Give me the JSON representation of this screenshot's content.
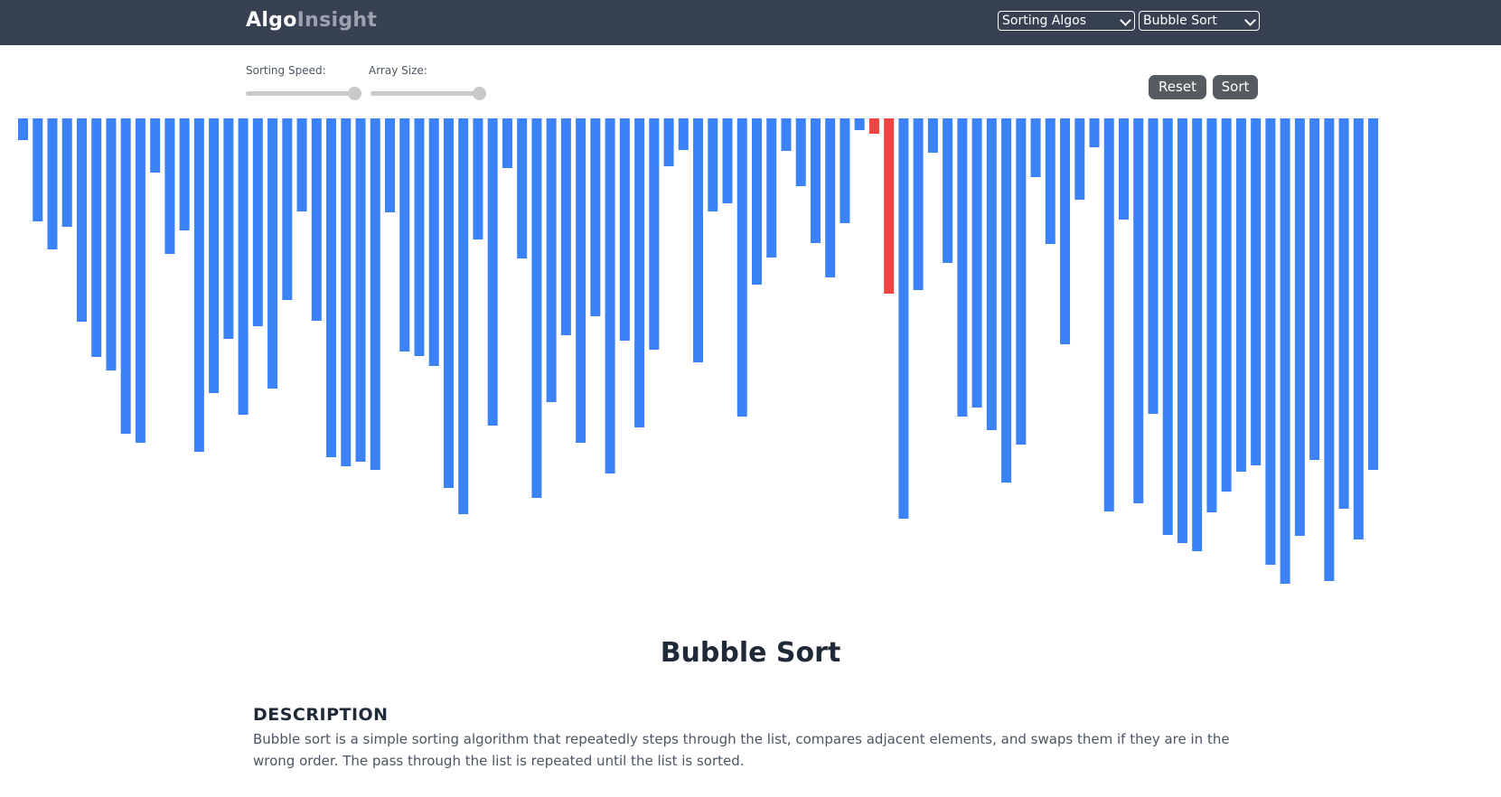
{
  "navbar": {
    "brand_part1": "Algo",
    "brand_part2": "Insight",
    "category_select": "Sorting Algos",
    "algorithm_select": "Bubble Sort"
  },
  "controls": {
    "speed_label": "Sorting Speed:",
    "size_label": "Array Size:",
    "speed_value": 1.0,
    "size_value": 1.0,
    "reset_label": "Reset",
    "sort_label": "Sort"
  },
  "colors": {
    "navbar": "#374151",
    "bar_default": "#3b82f6",
    "bar_compare": "#ef4444"
  },
  "array": {
    "values": [
      24,
      114,
      145,
      120,
      225,
      264,
      279,
      349,
      359,
      60,
      150,
      124,
      369,
      304,
      244,
      328,
      230,
      299,
      201,
      103,
      224,
      375,
      385,
      380,
      389,
      104,
      258,
      263,
      274,
      409,
      438,
      134,
      340,
      55,
      155,
      420,
      314,
      240,
      359,
      219,
      393,
      246,
      342,
      256,
      53,
      35,
      270,
      103,
      94,
      330,
      184,
      154,
      36,
      75,
      138,
      176,
      116,
      13,
      17,
      194,
      443,
      190,
      38,
      160,
      330,
      320,
      345,
      403,
      361,
      65,
      139,
      250,
      90,
      32,
      435,
      112,
      426,
      327,
      461,
      470,
      479,
      436,
      413,
      391,
      384,
      494,
      515,
      462,
      378,
      512,
      432,
      466,
      389
    ],
    "max_value": 515,
    "compare_indices": [
      58,
      59
    ]
  },
  "algorithm": {
    "title": "Bubble Sort",
    "description_heading": "DESCRIPTION",
    "description": "Bubble sort is a simple sorting algorithm that repeatedly steps through the list, compares adjacent elements, and swaps them if they are in the wrong order. The pass through the list is repeated until the list is sorted."
  }
}
